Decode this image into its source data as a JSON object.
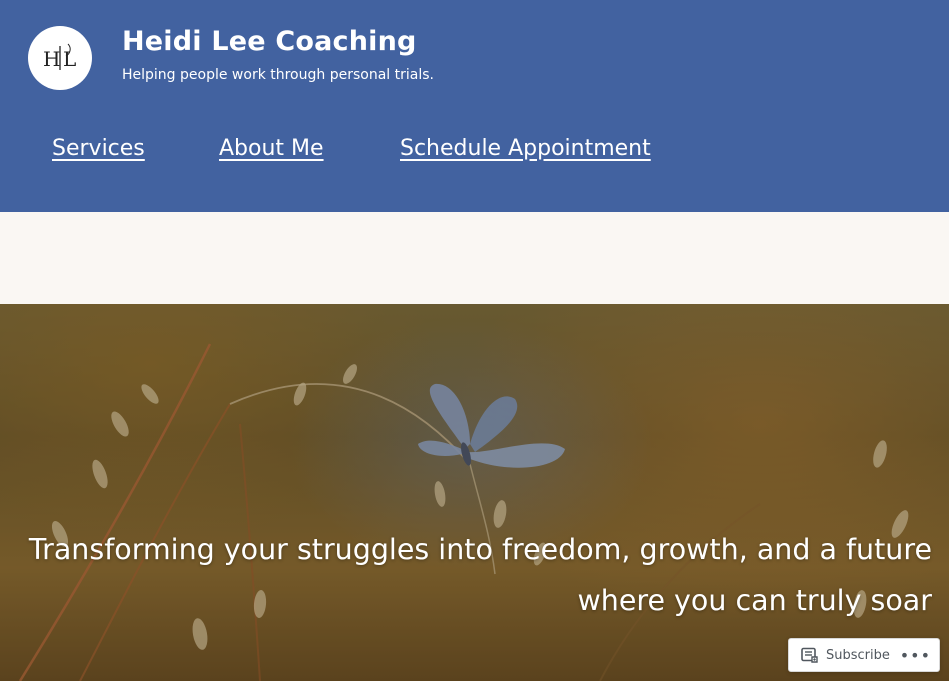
{
  "header": {
    "logo_icon": "heidi-lee-monogram-logo",
    "logo_monogram": "H|L",
    "site_title": "Heidi Lee Coaching",
    "tagline": "Helping people work through personal trials."
  },
  "nav": {
    "items": [
      {
        "label": "Services"
      },
      {
        "label": "About Me"
      },
      {
        "label": "Schedule Appointment"
      }
    ]
  },
  "hero": {
    "line1": "Transforming your struggles into freedom, growth, and a future",
    "line2": "where you can truly soar",
    "image_icon": "butterfly-on-grass-photo"
  },
  "subscribe_bar": {
    "subscribe_label": "Subscribe",
    "subscribe_icon": "reader-icon",
    "more_icon": "ellipsis-icon",
    "more_label": "•••"
  },
  "colors": {
    "header_bg": "#4262a0",
    "page_bg": "#faf7f3",
    "text_on_header": "#ffffff"
  }
}
